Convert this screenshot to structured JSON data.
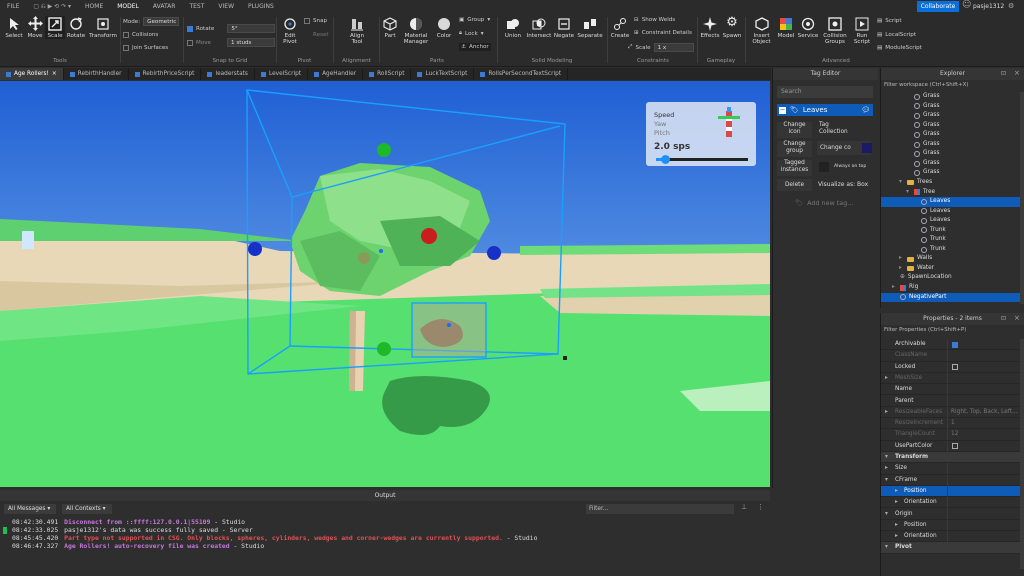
{
  "menu": {
    "tabs": [
      "FILE",
      "HOME",
      "MODEL",
      "AVATAR",
      "TEST",
      "VIEW",
      "PLUGINS"
    ],
    "active": "MODEL"
  },
  "ribbon": {
    "tools": {
      "select": "Select",
      "move": "Move",
      "scale": "Scale",
      "rotate": "Rotate",
      "transform": "Transform",
      "group": "Tools"
    },
    "mode_label": "Mode:",
    "mode_value": "Geometric",
    "collisions": "Collisions",
    "join_surfaces": "Join Surfaces",
    "snap": {
      "rotate": "Rotate",
      "rotate_value": "5°",
      "move": "Move",
      "move_value": "1 studs",
      "group": "Snap to Grid"
    },
    "pivot": {
      "edit": "Edit\nPivot",
      "snap": "Snap",
      "reset": "Reset",
      "group": "Pivot"
    },
    "align": {
      "tool": "Align\nTool",
      "group": "Alignment"
    },
    "parts": {
      "part": "Part",
      "material": "Material\nManager",
      "color": "Color",
      "group_btn": "Group",
      "lock": "Lock",
      "anchor": "Anchor",
      "group": "Parts"
    },
    "solid": {
      "union": "Union",
      "intersect": "Intersect",
      "negate": "Negate",
      "separate": "Separate",
      "group": "Solid Modeling"
    },
    "constraints": {
      "create": "Create",
      "show_welds": "Show Welds",
      "constraint_details": "Constraint Details",
      "scale": "Scale",
      "scale_value": "1 x",
      "group": "Constraints"
    },
    "gameplay": {
      "effects": "Effects",
      "spawn": "Spawn",
      "group": "Gameplay"
    },
    "advanced": {
      "insert": "Insert\nObject",
      "model": "Model",
      "service": "Service",
      "collision": "Collision\nGroups",
      "run": "Run\nScript",
      "script": "Script",
      "local": "LocalScript",
      "module": "ModuleScript",
      "group": "Advanced"
    },
    "collaborate": "Collaborate",
    "user": "pasje1312"
  },
  "tabs": [
    "Age Rollers!",
    "RebirthHandler",
    "RebirthPriceScript",
    "leaderstats",
    "LevelScript",
    "AgeHandler",
    "RollScript",
    "LuckTextScript",
    "RollsPerSecondTextScript"
  ],
  "hud": {
    "speed": "Speed",
    "yaw": "Yaw",
    "pitch": "Pitch",
    "value": "2.0 sps",
    "slider": 0.1
  },
  "output": {
    "title": "Output",
    "all_messages": "All Messages",
    "all_contexts": "All Contexts",
    "filter": "Filter...",
    "logs": [
      {
        "time": "08:42:30.491",
        "msg": "Disconnect from ::ffff:127.0.0.1|55109",
        "src": "Studio",
        "color": "#c678dd"
      },
      {
        "time": "08:42:33.025",
        "msg": "pasje1312's data was success fully saved",
        "src": "Server",
        "color": "#dddddd"
      },
      {
        "time": "08:45:45.420",
        "msg": "Part type not supported in CSG. Only blocks, spheres, cylinders, wedges and corner-wedges are currently supported.",
        "src": "Studio",
        "color": "#e05252"
      },
      {
        "time": "08:46:47.327",
        "msg": "Age Rollers! auto-recovery file was created",
        "src": "Studio",
        "color": "#c678dd"
      }
    ]
  },
  "tag_editor": {
    "title": "Tag Editor",
    "search": "Search",
    "tag": "Leaves",
    "change_icon": "Change\nicon",
    "tag_collection": "Tag\nCollection",
    "change_group": "Change\ngroup",
    "change_color": "Change co",
    "tagged_instances": "Tagged\ninstances",
    "always_on_top": "Always on top",
    "delete": "Delete",
    "visualize": "Visualize as: Box",
    "add_new": "Add new tag...",
    "color": "#1a1a66"
  },
  "explorer": {
    "title": "Explorer",
    "filter": "Filter workspace (Ctrl+Shift+X)",
    "items": [
      {
        "label": "Grass",
        "indent": 3,
        "icon": "part"
      },
      {
        "label": "Grass",
        "indent": 3,
        "icon": "part"
      },
      {
        "label": "Grass",
        "indent": 3,
        "icon": "part"
      },
      {
        "label": "Grass",
        "indent": 3,
        "icon": "part"
      },
      {
        "label": "Grass",
        "indent": 3,
        "icon": "part"
      },
      {
        "label": "Grass",
        "indent": 3,
        "icon": "part"
      },
      {
        "label": "Grass",
        "indent": 3,
        "icon": "part"
      },
      {
        "label": "Grass",
        "indent": 3,
        "icon": "part"
      },
      {
        "label": "Grass",
        "indent": 3,
        "icon": "part"
      },
      {
        "label": "Trees",
        "indent": 2,
        "icon": "folder"
      },
      {
        "label": "Tree",
        "indent": 3,
        "icon": "model"
      },
      {
        "label": "Leaves",
        "indent": 4,
        "icon": "part",
        "selected": true
      },
      {
        "label": "Leaves",
        "indent": 4,
        "icon": "part"
      },
      {
        "label": "Leaves",
        "indent": 4,
        "icon": "part"
      },
      {
        "label": "Trunk",
        "indent": 4,
        "icon": "part"
      },
      {
        "label": "Trunk",
        "indent": 4,
        "icon": "part"
      },
      {
        "label": "Trunk",
        "indent": 4,
        "icon": "part"
      },
      {
        "label": "Walls",
        "indent": 2,
        "icon": "folder"
      },
      {
        "label": "Water",
        "indent": 2,
        "icon": "folder"
      },
      {
        "label": "SpawnLocation",
        "indent": 1,
        "icon": "spawn"
      },
      {
        "label": "Rig",
        "indent": 1,
        "icon": "model"
      },
      {
        "label": "NegativePart",
        "indent": 1,
        "icon": "part",
        "selected": true
      }
    ]
  },
  "properties": {
    "title": "Properties - 2 items",
    "filter": "Filter Properties (Ctrl+Shift+P)",
    "rows": [
      {
        "k": "Archivable",
        "v": "",
        "check": "on"
      },
      {
        "k": "ClassName",
        "v": "",
        "dim": true
      },
      {
        "k": "Locked",
        "v": "",
        "check": "off"
      },
      {
        "k": "MeshSize",
        "v": "",
        "dim": true,
        "arrow": true
      },
      {
        "k": "Name",
        "v": ""
      },
      {
        "k": "Parent",
        "v": ""
      },
      {
        "k": "ResizeableFaces",
        "v": "Right, Top, Back, Left...",
        "dim": true,
        "arrow": true
      },
      {
        "k": "ResizeIncrement",
        "v": "1",
        "dim": true
      },
      {
        "k": "TriangleCount",
        "v": "12",
        "dim": true
      },
      {
        "k": "UsePartColor",
        "v": "",
        "check": "off"
      },
      {
        "k": "Transform",
        "v": "",
        "hdr": true
      },
      {
        "k": "Size",
        "v": "",
        "arrow": true
      },
      {
        "k": "CFrame",
        "v": "",
        "arrow": true,
        "open": true
      },
      {
        "k": "Position",
        "v": "",
        "sel": true,
        "sub": true,
        "arrow": true
      },
      {
        "k": "Orientation",
        "v": "",
        "sub": true,
        "arrow": true
      },
      {
        "k": "Origin",
        "v": "",
        "arrow": true,
        "open": true
      },
      {
        "k": "Position",
        "v": "",
        "sub": true,
        "arrow": true
      },
      {
        "k": "Orientation",
        "v": "",
        "sub": true,
        "arrow": true
      },
      {
        "k": "Pivot",
        "v": "",
        "hdr": true
      }
    ]
  }
}
